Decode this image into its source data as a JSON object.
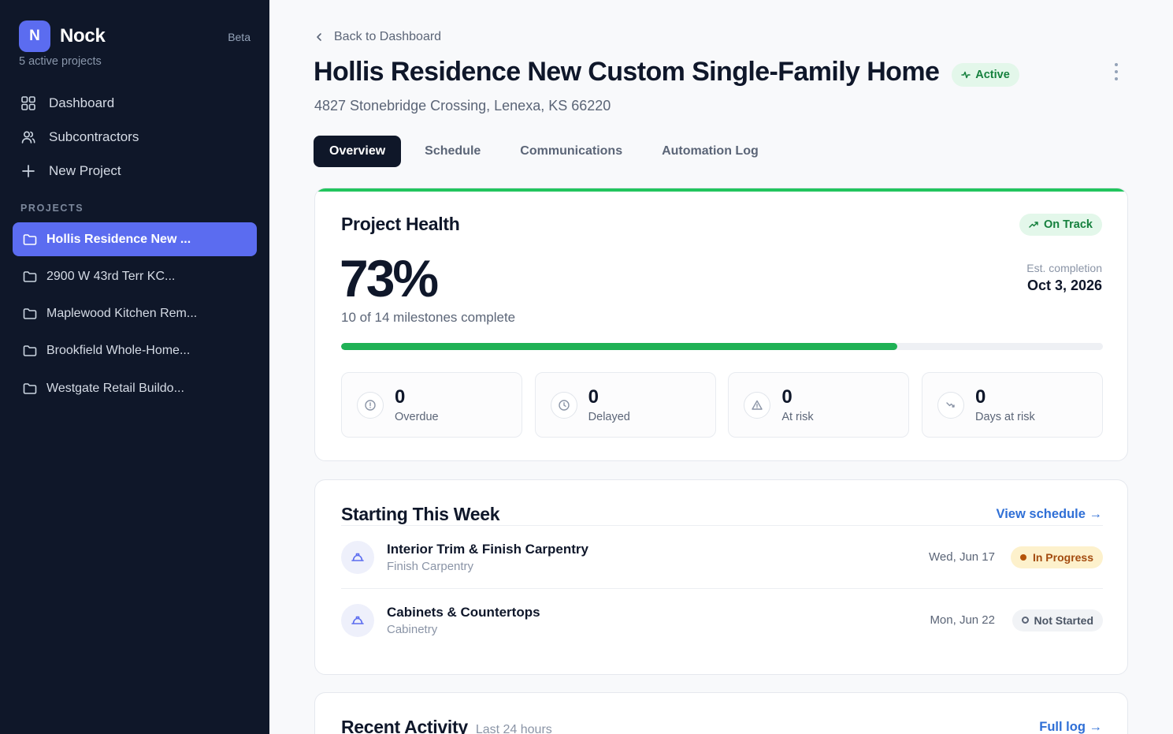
{
  "sidebar": {
    "logo_letter": "N",
    "brand": "Nock",
    "beta": "Beta",
    "active_projects": "5 active projects",
    "nav": [
      {
        "label": "Dashboard",
        "icon": "grid-icon"
      },
      {
        "label": "Subcontractors",
        "icon": "users-icon"
      },
      {
        "label": "New Project",
        "icon": "plus-icon"
      }
    ],
    "section_label": "PROJECTS",
    "projects": [
      {
        "label": "Hollis Residence New ...",
        "active": true
      },
      {
        "label": "2900 W 43rd Terr KC..."
      },
      {
        "label": "Maplewood Kitchen Rem..."
      },
      {
        "label": "Brookfield Whole-Home..."
      },
      {
        "label": "Westgate Retail Buildo..."
      }
    ]
  },
  "header": {
    "back": "Back to Dashboard",
    "title": "Hollis Residence New Custom Single-Family Home",
    "status": "Active",
    "address": "4827 Stonebridge Crossing, Lenexa, KS 66220"
  },
  "tabs": [
    "Overview",
    "Schedule",
    "Communications",
    "Automation Log"
  ],
  "health": {
    "title": "Project Health",
    "badge": "On Track",
    "percent": "73%",
    "progress_fraction": 0.73,
    "milestones": "10 of 14 milestones complete",
    "est_label": "Est. completion",
    "est_date": "Oct 3, 2026",
    "stats": [
      {
        "value": "0",
        "label": "Overdue",
        "icon": "alert-circle-icon"
      },
      {
        "value": "0",
        "label": "Delayed",
        "icon": "clock-icon"
      },
      {
        "value": "0",
        "label": "At risk",
        "icon": "warning-triangle-icon"
      },
      {
        "value": "0",
        "label": "Days at risk",
        "icon": "trending-down-icon"
      }
    ]
  },
  "week": {
    "title": "Starting This Week",
    "link": "View schedule →",
    "items": [
      {
        "title": "Interior Trim & Finish Carpentry",
        "trade": "Finish Carpentry",
        "date": "Wed, Jun 17",
        "status": "In Progress"
      },
      {
        "title": "Cabinets & Countertops",
        "trade": "Cabinetry",
        "date": "Mon, Jun 22",
        "status": "Not Started"
      }
    ]
  },
  "recent": {
    "title": "Recent Activity",
    "subtitle": "Last 24 hours",
    "link": "Full log →"
  },
  "colors": {
    "sidebar_bg": "#0f1729",
    "accent": "#5b6cf0",
    "success": "#22c55e",
    "link": "#2f6fd6",
    "warning": "#b45309"
  }
}
